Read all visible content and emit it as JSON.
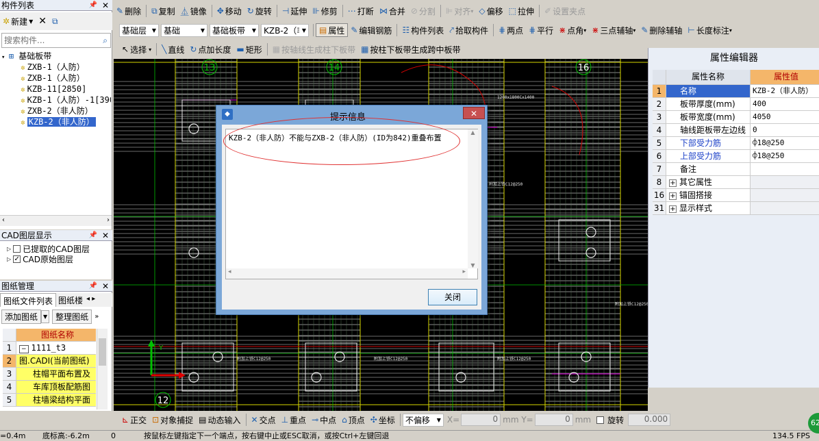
{
  "left_panel": {
    "title": "构件列表",
    "new_label": "新建",
    "search_placeholder": "搜索构件...",
    "tree_root": "基础板带",
    "tree_items": [
      "ZXB-1（人防）",
      "ZXB-1（人防）",
      "KZB-11[2850]",
      "KZB-1（人防）-1[390",
      "ZXB-2（非人防）",
      "KZB-2（非人防）"
    ],
    "selected_index": 5
  },
  "cad_panel": {
    "title": "CAD图层显示",
    "items": [
      {
        "label": "已提取的CAD图层",
        "checked": false
      },
      {
        "label": "CAD原始图层",
        "checked": true
      }
    ]
  },
  "drawing_panel": {
    "title": "图纸管理",
    "tabs": [
      "图纸文件列表",
      "图纸楼"
    ],
    "add_label": "添加图纸",
    "organize_label": "整理图纸",
    "col_header": "图纸名称",
    "rows": [
      {
        "n": "1",
        "text": "1111_t3"
      },
      {
        "n": "2",
        "text": "图.CADI(当前图纸)"
      },
      {
        "n": "3",
        "text": "柱帽平面布置及"
      },
      {
        "n": "4",
        "text": "车库顶板配筋图"
      },
      {
        "n": "5",
        "text": "柱墙梁结构平面"
      }
    ]
  },
  "toolbar1": [
    "删除",
    "复制",
    "镜像",
    "移动",
    "旋转",
    "延伸",
    "修剪",
    "打断",
    "合并",
    "分割",
    "对齐",
    "偏移",
    "拉伸",
    "设置夹点"
  ],
  "toolbar2": {
    "layer": "基础层",
    "category": "基础",
    "type": "基础板带",
    "component": "KZB-2（非",
    "buttons": [
      "属性",
      "编辑钢筋",
      "构件列表",
      "拾取构件",
      "两点",
      "平行",
      "点角",
      "三点辅轴",
      "删除辅轴",
      "长度标注"
    ]
  },
  "toolbar3": {
    "select": "选择",
    "buttons": [
      "直线",
      "点加长度",
      "矩形",
      "按轴线生成柱下板带",
      "按柱下板带生成跨中板带"
    ]
  },
  "canvas": {
    "axis_labels": [
      "13",
      "14",
      "16",
      "12"
    ],
    "annotations": [
      "1200x1800Cx1400",
      "附加上铁C12@250",
      "附加上铁C12@250",
      "附加上铁C12@250",
      "附加上铁C12@250",
      "附加上铁C12@250"
    ]
  },
  "dialog": {
    "title": "提示信息",
    "message": "KZB-2（非人防）不能与ZXB-2（非人防）(ID为842)重叠布置",
    "close_label": "关闭"
  },
  "props": {
    "title": "属性编辑器",
    "col_name": "属性名称",
    "col_value": "属性值",
    "rows": [
      {
        "n": "1",
        "k": "名称",
        "v": "KZB-2（非人防）",
        "blue": true,
        "plus": false
      },
      {
        "n": "2",
        "k": "板带厚度(mm)",
        "v": "400",
        "blue": false,
        "plus": false
      },
      {
        "n": "3",
        "k": "板带宽度(mm)",
        "v": "4050",
        "blue": false,
        "plus": false
      },
      {
        "n": "4",
        "k": "轴线距板带左边线",
        "v": "0",
        "blue": false,
        "plus": false
      },
      {
        "n": "5",
        "k": "下部受力筋",
        "v": "⌽18@250",
        "blue": true,
        "plus": false
      },
      {
        "n": "6",
        "k": "上部受力筋",
        "v": "⌽18@250",
        "blue": true,
        "plus": false
      },
      {
        "n": "7",
        "k": "备注",
        "v": "",
        "blue": false,
        "plus": false
      },
      {
        "n": "8",
        "k": "其它属性",
        "v": "",
        "blue": false,
        "plus": true
      },
      {
        "n": "16",
        "k": "锚固搭接",
        "v": "",
        "blue": false,
        "plus": true
      },
      {
        "n": "31",
        "k": "显示样式",
        "v": "",
        "blue": false,
        "plus": true
      }
    ]
  },
  "bottom_bar": {
    "buttons": [
      "正交",
      "对象捕捉",
      "动态输入",
      "交点",
      "重点",
      "中点",
      "顶点",
      "坐标"
    ],
    "offset_mode": "不偏移",
    "x_label": "X=",
    "x_value": "0",
    "y_label": "mm Y=",
    "y_value": "0",
    "unit": "mm",
    "rotate_label": "旋转",
    "rotate_value": "0.000"
  },
  "status": {
    "left": "=0.4m",
    "base": "底标高:-6.2m",
    "zero": "0",
    "hint": "按鼠标左键指定下一个端点，按右键中止或ESC取消，或按Ctrl+左键回退",
    "fps": "134.5 FPS",
    "badge": "62"
  },
  "colors": {
    "accent": "#1e5fae",
    "canvas_bg": "#000000",
    "highlight": "#ffff66",
    "selected": "#3366cc"
  }
}
